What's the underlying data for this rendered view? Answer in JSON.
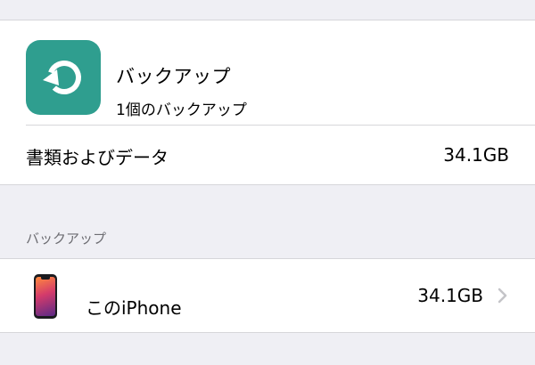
{
  "app": {
    "title": "バックアップ",
    "subtitle": "1個のバックアップ",
    "icon": "backup-restore-icon",
    "icon_color": "#2f9e8f"
  },
  "documents": {
    "label": "書類およびデータ",
    "value": "34.1GB"
  },
  "backups_section": {
    "header": "バックアップ",
    "items": [
      {
        "label": "このiPhone",
        "value": "34.1GB",
        "icon": "iphone-icon"
      }
    ]
  }
}
